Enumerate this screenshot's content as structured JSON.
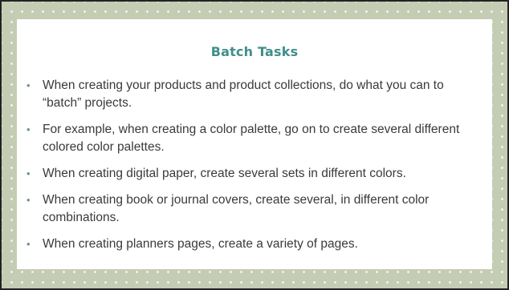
{
  "slide": {
    "title": "Batch Tasks",
    "bullet_marker": "•",
    "bullets": [
      "When creating your products and product collections, do what you can to “batch” projects.",
      "For example, when creating a color palette, go on to create several different colored color palettes.",
      "When creating digital paper, create several sets in different colors.",
      "When creating book or journal covers, create several, in different color combinations.",
      "When creating planners pages, create a variety of pages."
    ]
  },
  "colors": {
    "frame_background": "#c4ccb3",
    "title_color": "#3f8f8a",
    "body_text_color": "#3a3a3a"
  }
}
